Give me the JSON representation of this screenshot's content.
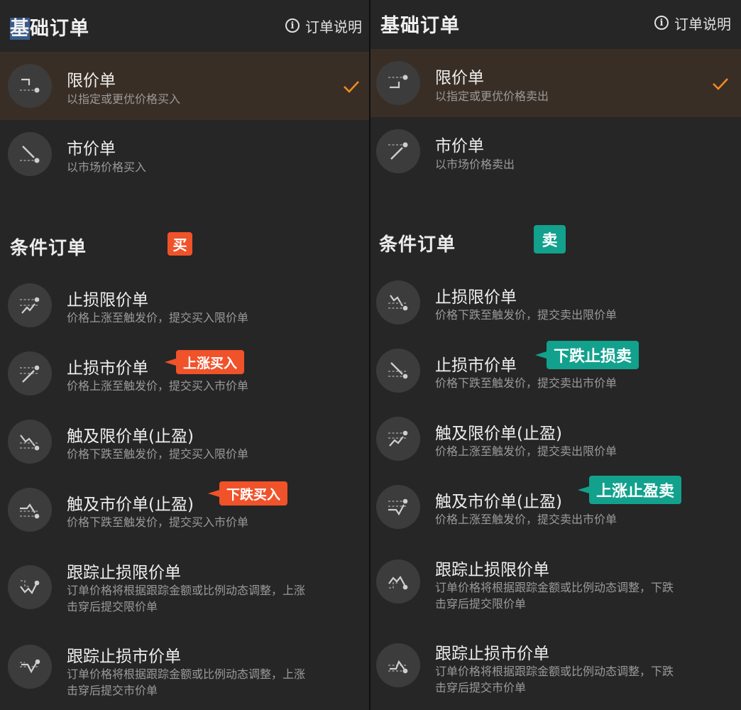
{
  "colors": {
    "buy": "#f0522a",
    "sell": "#12a18c",
    "check": "#f08a24"
  },
  "left": {
    "header": {
      "title_sel": "基",
      "title_rest": "础订单",
      "info_label": "订单说明",
      "info_icon": "info-icon"
    },
    "basic": [
      {
        "title": "限价单",
        "desc": "以指定或更优价格买入",
        "selected": true,
        "icon": "limit-order-icon"
      },
      {
        "title": "市价单",
        "desc": "以市场价格买入",
        "selected": false,
        "icon": "market-order-icon"
      }
    ],
    "section_title": "条件订单",
    "badge": "买",
    "conditional": [
      {
        "title": "止损限价单",
        "desc": "价格上涨至触发价，提交买入限价单",
        "icon": "stop-limit-icon"
      },
      {
        "title": "止损市价单",
        "desc": "价格上涨至触发价，提交买入市价单",
        "tag": "上涨买入",
        "icon": "stop-market-icon"
      },
      {
        "title": "触及限价单(止盈)",
        "desc": "价格下跌至触发价，提交买入限价单",
        "icon": "touch-limit-icon"
      },
      {
        "title": "触及市价单(止盈)",
        "desc": "价格下跌至触发价，提交买入市价单",
        "tag": "下跌买入",
        "icon": "touch-market-icon"
      },
      {
        "title": "跟踪止损限价单",
        "desc1": "订单价格将根据跟踪金额或比例动态调整，上涨",
        "desc2": "击穿后提交限价单",
        "icon": "trailing-stop-limit-icon"
      },
      {
        "title": "跟踪止损市价单",
        "desc1": "订单价格将根据跟踪金额或比例动态调整，上涨",
        "desc2": "击穿后提交市价单",
        "icon": "trailing-stop-market-icon"
      }
    ]
  },
  "right": {
    "header": {
      "title": "基础订单",
      "info_label": "订单说明",
      "info_icon": "info-icon"
    },
    "basic": [
      {
        "title": "限价单",
        "desc": "以指定或更优价格卖出",
        "selected": true,
        "icon": "limit-order-icon"
      },
      {
        "title": "市价单",
        "desc": "以市场价格卖出",
        "selected": false,
        "icon": "market-order-icon"
      }
    ],
    "section_title": "条件订单",
    "badge": "卖",
    "conditional": [
      {
        "title": "止损限价单",
        "desc": "价格下跌至触发价，提交卖出限价单",
        "icon": "stop-limit-icon"
      },
      {
        "title": "止损市价单",
        "desc": "价格下跌至触发价，提交卖出市价单",
        "tag": "下跌止损卖",
        "icon": "stop-market-icon"
      },
      {
        "title": "触及限价单(止盈)",
        "desc": "价格上涨至触发价，提交卖出限价单",
        "icon": "touch-limit-icon"
      },
      {
        "title": "触及市价单(止盈)",
        "desc": "价格上涨至触发价，提交卖出市价单",
        "tag": "上涨止盈卖",
        "icon": "touch-market-icon"
      },
      {
        "title": "跟踪止损限价单",
        "desc1": "订单价格将根据跟踪金额或比例动态调整，下跌",
        "desc2": "击穿后提交限价单",
        "icon": "trailing-stop-limit-icon"
      },
      {
        "title": "跟踪止损市价单",
        "desc1": "订单价格将根据跟踪金额或比例动态调整，下跌",
        "desc2": "击穿后提交市价单",
        "icon": "trailing-stop-market-icon"
      }
    ]
  }
}
